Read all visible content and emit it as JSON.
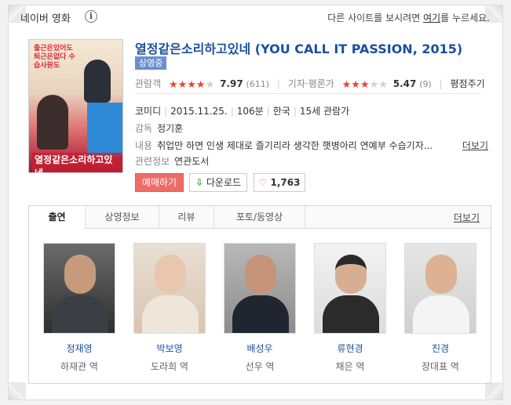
{
  "header": {
    "title": "네이버 영화",
    "info_glyph": "i",
    "note_prefix": "다른 사이트를 보시려면 ",
    "note_link": "여기",
    "note_suffix": "를 누르세요."
  },
  "movie": {
    "title": "열정같은소리하고있네 (YOU CALL IT PASSION, 2015)",
    "status_badge": "상영중",
    "poster_tagline": "출근은있어도 퇴근은없다 수습사원도",
    "poster_title": "열정같은소리하고있네",
    "audience": {
      "label": "관람객",
      "score": "7.97",
      "count": "(611)",
      "stars": 4
    },
    "critics": {
      "label": "기자·평론가",
      "score": "5.47",
      "count": "(9)",
      "stars": 3,
      "extra_link": "평점주기"
    },
    "genre": "코미디",
    "release": "2015.11.25.",
    "runtime": "106분",
    "country": "한국",
    "rating": "15세 관람가",
    "director_label": "감독",
    "director": "정기훈",
    "plot_label": "내용",
    "plot": "취업만 하면 인생 제대로 즐기리라 생각한 햇병아리 연예부 수습기자...",
    "plot_more": "더보기",
    "related_label": "관련정보",
    "related": "연관도서"
  },
  "buttons": {
    "reserve": "예매하기",
    "download": "다운로드",
    "likes": "1,763"
  },
  "tabs": {
    "items": [
      "출연",
      "상영정보",
      "리뷰",
      "포토/동영상"
    ],
    "more": "더보기"
  },
  "cast": [
    {
      "name": "정재영",
      "role": "하재관 역"
    },
    {
      "name": "박보영",
      "role": "도라희 역"
    },
    {
      "name": "배성우",
      "role": "선우 역"
    },
    {
      "name": "류현경",
      "role": "채은 역"
    },
    {
      "name": "진경",
      "role": "장대표 역"
    }
  ],
  "colors": {
    "title_blue": "#1a4fa0",
    "star_red": "#e8452e",
    "reserve_button": "#ef6b68",
    "badge_blue": "#6b8fcf"
  }
}
